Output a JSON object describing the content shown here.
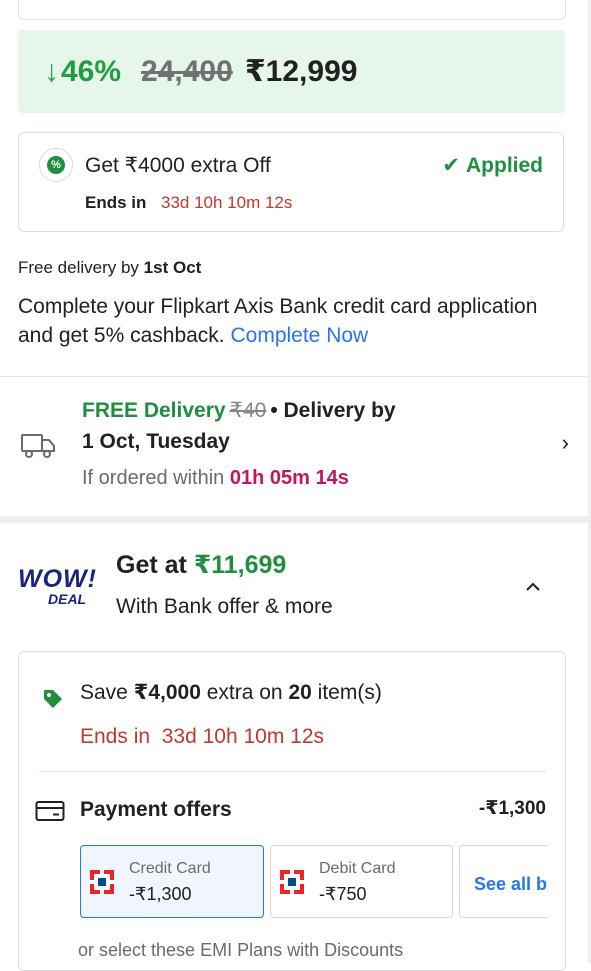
{
  "price": {
    "discount_arrow": "↓",
    "discount": "46%",
    "mrp": "24,400",
    "selling_price": "₹12,999"
  },
  "extra_offer": {
    "title": "Get ₹4000 extra Off",
    "status": "Applied",
    "ends_label": "Ends in",
    "ends_time": "33d 10h 10m 12s"
  },
  "free_delivery_line": {
    "prefix": "Free delivery by",
    "date": "1st Oct"
  },
  "axis_offer": {
    "text": "Complete your Flipkart Axis Bank credit card application and get 5% cashback.",
    "link": "Complete Now"
  },
  "delivery": {
    "free_label": "FREE Delivery",
    "strike_price": "₹40",
    "separator": "•",
    "delivery_by": "Delivery by",
    "date": "1 Oct, Tuesday",
    "order_within": "If ordered within",
    "countdown": "01h 05m  14s"
  },
  "wow_deal": {
    "logo_top": "WOW!",
    "logo_bottom": "DEAL",
    "get_at": "Get at",
    "price": "₹11,699",
    "subtitle": "With Bank offer & more"
  },
  "bulk_offer": {
    "save_prefix": "Save",
    "save_amount": "₹4,000",
    "save_mid": "extra on",
    "count": "20",
    "save_suffix": "item(s)",
    "ends_label": "Ends in",
    "ends_time": "33d 10h 10m 12s"
  },
  "payment_offers": {
    "label": "Payment offers",
    "amount": "-₹1,300",
    "options": [
      {
        "name": "Credit Card",
        "value": "-₹1,300",
        "selected": true
      },
      {
        "name": "Debit Card",
        "value": "-₹750",
        "selected": false
      }
    ],
    "see_all": "See all b"
  },
  "emi_text": "or select these EMI Plans with Discounts",
  "colors": {
    "green": "#1f8f3f",
    "red": "#c0392b",
    "blue": "#2874f0",
    "magenta": "#c2185b",
    "price_bg": "#e6f6ea"
  }
}
